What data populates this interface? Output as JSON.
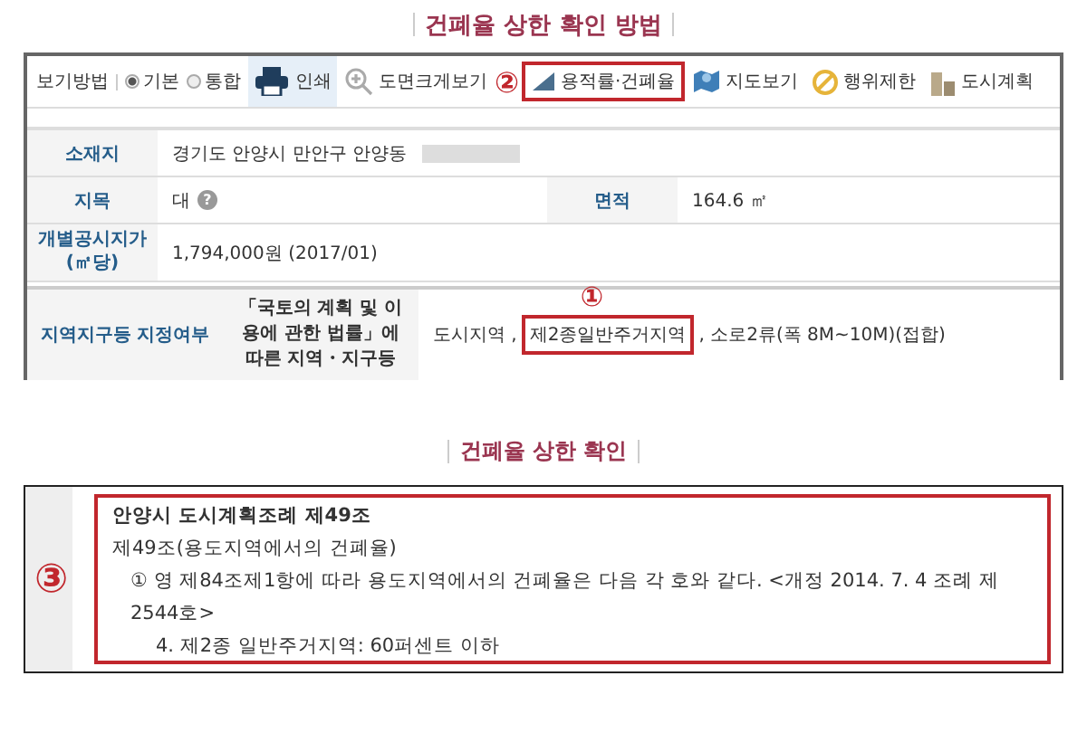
{
  "heading": "건폐율 상한 확인 방법",
  "toolbar": {
    "view_label": "보기방법",
    "view_options": [
      {
        "label": "기본",
        "selected": true
      },
      {
        "label": "통합",
        "selected": false
      }
    ],
    "buttons": [
      {
        "label": "인쇄",
        "kind": "print",
        "selected": true
      },
      {
        "label": "도면크게보기",
        "kind": "zoom",
        "selected": false
      },
      {
        "label": "용적률·건폐율",
        "kind": "ruler",
        "selected": false,
        "callout": "②"
      },
      {
        "label": "지도보기",
        "kind": "map",
        "selected": false
      },
      {
        "label": "행위제한",
        "kind": "ban",
        "selected": false
      },
      {
        "label": "도시계획",
        "kind": "building",
        "selected": false
      }
    ]
  },
  "land": {
    "address_label": "소재지",
    "address": "경기도 안양시 만안구 안양동",
    "category_label": "지목",
    "category": "대",
    "category_help": "?",
    "area_label": "면적",
    "area": "164.6 ㎡",
    "price_label": "개별공시지가(㎡당)",
    "price": "1,794,000원 (2017/01)",
    "zone_label": "지역지구등 지정여부",
    "zone_law": "「국토의 계획 및 이용에 관한 법률」에 따른 지역・지구등",
    "zone_before": "도시지역 ,",
    "zone_marked": "제2종일반주거지역",
    "zone_callout": "①",
    "zone_after": ", 소로2류(폭 8M~10M)(접합)"
  },
  "heading2": "건폐율 상한 확인",
  "ordinance": {
    "callout": "③",
    "title": "안양시 도시계획조례 제49조",
    "article": "제49조(용도지역에서의 건폐율)",
    "clause": "① 영 제84조제1항에 따라 용도지역에서의 건폐율은 다음 각 호와 같다. <개정 2014. 7. 4 조례 제2544호>",
    "item": "4. 제2종 일반주거지역: 60퍼센트 이하"
  }
}
